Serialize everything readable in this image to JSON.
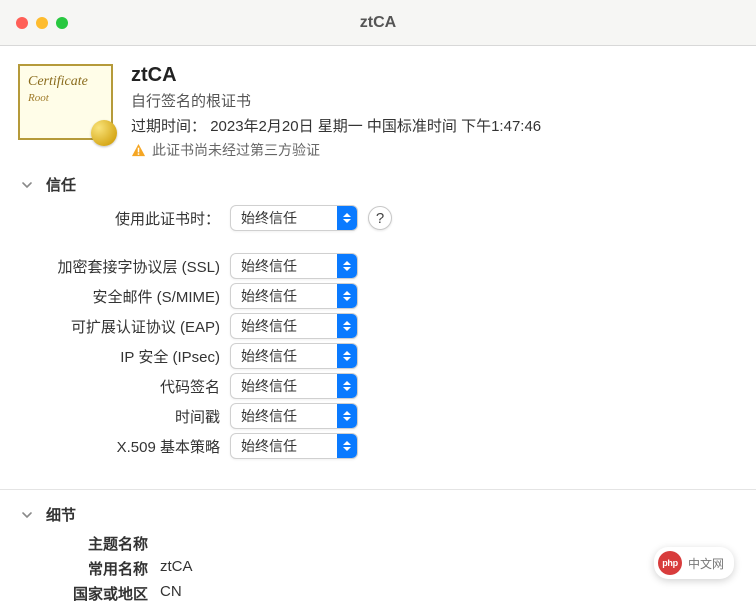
{
  "window": {
    "title": "ztCA"
  },
  "cert": {
    "icon_title": "Certificate",
    "icon_root": "Root",
    "name": "ztCA",
    "type": "自行签名的根证书",
    "expiry_label": "过期时间：",
    "expiry_value": "2023年2月20日 星期一 中国标准时间 下午1:47:46",
    "warning": "此证书尚未经过第三方验证"
  },
  "sections": {
    "trust": "信任",
    "details": "细节"
  },
  "trust": {
    "when_using_label": "使用此证书时：",
    "when_using_value": "始终信任",
    "help": "?",
    "policies": [
      {
        "label": "加密套接字协议层 (SSL)",
        "value": "始终信任"
      },
      {
        "label": "安全邮件 (S/MIME)",
        "value": "始终信任"
      },
      {
        "label": "可扩展认证协议 (EAP)",
        "value": "始终信任"
      },
      {
        "label": "IP 安全 (IPsec)",
        "value": "始终信任"
      },
      {
        "label": "代码签名",
        "value": "始终信任"
      },
      {
        "label": "时间戳",
        "value": "始终信任"
      },
      {
        "label": "X.509 基本策略",
        "value": "始终信任"
      }
    ]
  },
  "details": {
    "subject_label": "主题名称",
    "rows": [
      {
        "label": "常用名称",
        "value": "ztCA"
      },
      {
        "label": "国家或地区",
        "value": "CN"
      }
    ]
  },
  "brand": {
    "logo": "php",
    "text": "中文网"
  }
}
